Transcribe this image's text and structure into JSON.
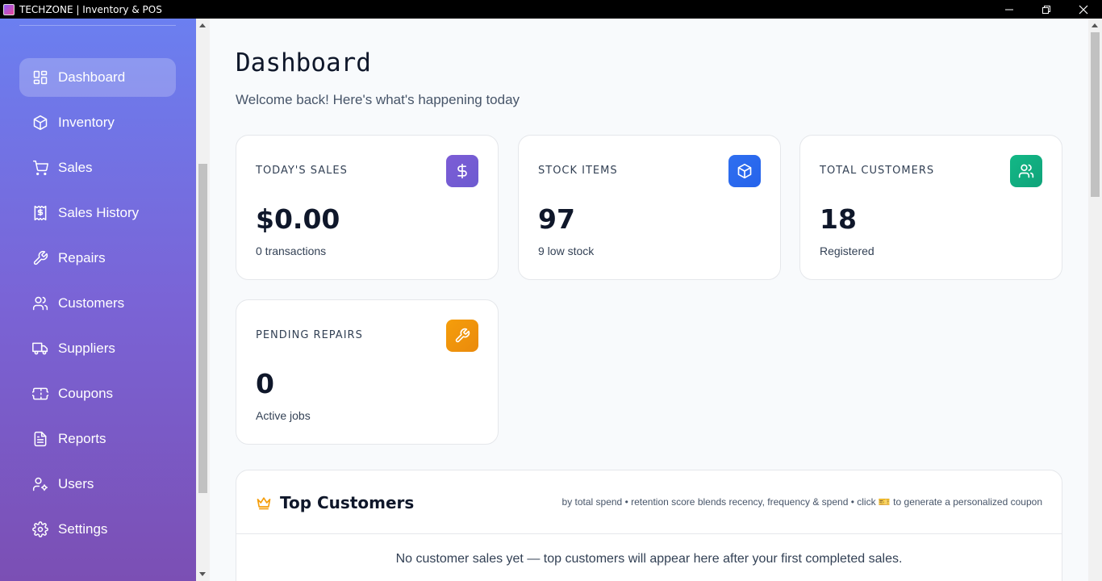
{
  "window": {
    "title": "TECHZONE | Inventory & POS",
    "controls": [
      "minimize-icon",
      "restore-icon",
      "close-icon"
    ]
  },
  "sidebar": {
    "items": [
      {
        "label": "Dashboard",
        "icon": "dashboard-icon",
        "active": true
      },
      {
        "label": "Inventory",
        "icon": "box-icon"
      },
      {
        "label": "Sales",
        "icon": "cart-icon"
      },
      {
        "label": "Sales History",
        "icon": "receipt-icon"
      },
      {
        "label": "Repairs",
        "icon": "wrench-icon"
      },
      {
        "label": "Customers",
        "icon": "users-icon"
      },
      {
        "label": "Suppliers",
        "icon": "truck-icon"
      },
      {
        "label": "Coupons",
        "icon": "ticket-icon"
      },
      {
        "label": "Reports",
        "icon": "file-icon"
      },
      {
        "label": "Users",
        "icon": "user-cog-icon"
      },
      {
        "label": "Settings",
        "icon": "gear-icon"
      }
    ]
  },
  "header": {
    "title": "Dashboard",
    "subtitle": "Welcome back! Here's what's happening today"
  },
  "stats": [
    {
      "label": "TODAY'S SALES",
      "value": "$0.00",
      "sub": "0 transactions",
      "icon": "dollar-icon",
      "color": "#7c5cd6"
    },
    {
      "label": "STOCK ITEMS",
      "value": "97",
      "sub": "9 low stock",
      "icon": "box-icon",
      "color": "#2563eb"
    },
    {
      "label": "TOTAL CUSTOMERS",
      "value": "18",
      "sub": "Registered",
      "icon": "users-icon",
      "color": "#10b981"
    },
    {
      "label": "PENDING REPAIRS",
      "value": "0",
      "sub": "Active jobs",
      "icon": "wrench-icon",
      "color": "#f59e0b"
    }
  ],
  "top_customers": {
    "title": "Top Customers",
    "note": "by total spend • retention score blends recency, frequency & spend • click 🎫 to generate a personalized coupon",
    "empty": "No customer sales yet — top customers will appear here after your first completed sales."
  },
  "colors": {
    "sidebar_top": "#6b7ff0",
    "sidebar_bottom": "#7b4fb4",
    "background": "#f8fafc"
  }
}
